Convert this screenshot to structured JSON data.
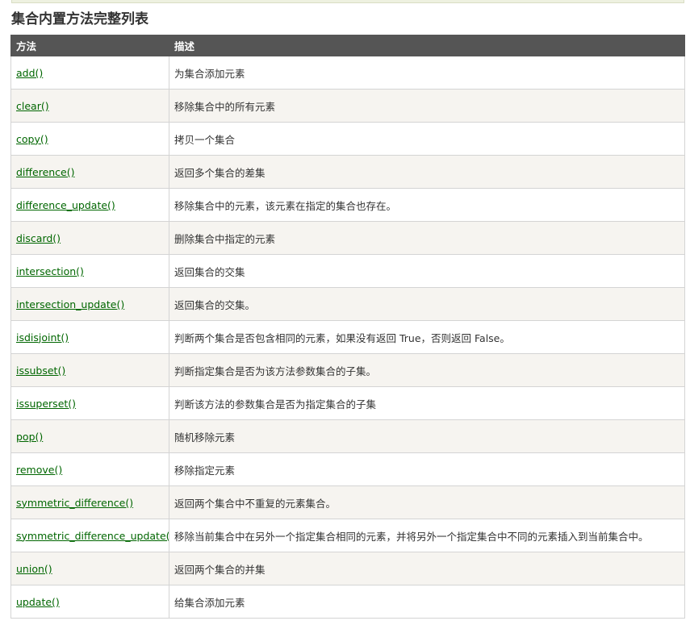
{
  "page": {
    "title": "集合内置方法完整列表"
  },
  "table": {
    "headers": [
      "方法",
      "描述"
    ],
    "rows": [
      {
        "method": "add()",
        "desc": "为集合添加元素"
      },
      {
        "method": "clear()",
        "desc": "移除集合中的所有元素"
      },
      {
        "method": "copy()",
        "desc": "拷贝一个集合"
      },
      {
        "method": "difference()",
        "desc": "返回多个集合的差集"
      },
      {
        "method": "difference_update()",
        "desc": "移除集合中的元素，该元素在指定的集合也存在。"
      },
      {
        "method": "discard()",
        "desc": "删除集合中指定的元素"
      },
      {
        "method": "intersection()",
        "desc": "返回集合的交集"
      },
      {
        "method": "intersection_update()",
        "desc": "返回集合的交集。"
      },
      {
        "method": "isdisjoint()",
        "desc": "判断两个集合是否包含相同的元素，如果没有返回 True，否则返回 False。"
      },
      {
        "method": "issubset()",
        "desc": "判断指定集合是否为该方法参数集合的子集。"
      },
      {
        "method": "issuperset()",
        "desc": "判断该方法的参数集合是否为指定集合的子集"
      },
      {
        "method": "pop()",
        "desc": "随机移除元素"
      },
      {
        "method": "remove()",
        "desc": "移除指定元素"
      },
      {
        "method": "symmetric_difference()",
        "desc": "返回两个集合中不重复的元素集合。"
      },
      {
        "method": "symmetric_difference_update()",
        "desc": "移除当前集合中在另外一个指定集合相同的元素，并将另外一个指定集合中不同的元素插入到当前集合中。"
      },
      {
        "method": "union()",
        "desc": "返回两个集合的并集"
      },
      {
        "method": "update()",
        "desc": "给集合添加元素"
      }
    ]
  },
  "colors": {
    "header_bg": "#555555",
    "link": "#006600",
    "row_alt": "#f6f4f0"
  }
}
